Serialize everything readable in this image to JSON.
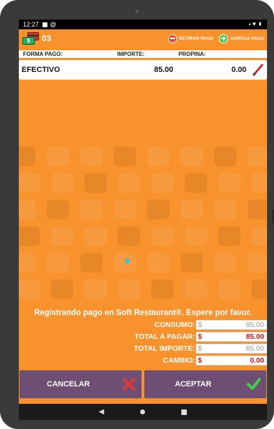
{
  "status": {
    "time": "12:27",
    "icons_right": "⬩▼▮"
  },
  "header": {
    "card_count": "03",
    "bill_symbol": "$",
    "remove_payment": "RETIRAR PAGO",
    "add_payment": "AGREGA PAGO"
  },
  "columns": {
    "method": "FORMA PAGO:",
    "amount": "IMPORTE:",
    "tip": "PROPINA:"
  },
  "payment": {
    "method": "EFECTIVO",
    "amount": "85.00",
    "tip": "0.00"
  },
  "message": "Registrando pago en Soft Restaurant®. Espere por favor.",
  "totals": [
    {
      "label": "CONSUMO:",
      "currency": "$",
      "value": "85.00",
      "style": "gray"
    },
    {
      "label": "TOTAL A PAGAR:",
      "currency": "$",
      "value": "85.00",
      "style": "red"
    },
    {
      "label": "TOTAL IMPORTE:",
      "currency": "$",
      "value": "85.00",
      "style": "gray"
    },
    {
      "label": "CAMBIO:",
      "currency": "$",
      "value": "0.00",
      "style": "red"
    }
  ],
  "buttons": {
    "cancel": "CANCELAR",
    "accept": "ACEPTAR"
  },
  "colors": {
    "background": "#f7922d",
    "button": "#6e4f73",
    "value_red": "#e01010"
  },
  "icons": [
    "camera-icon",
    "card-money-icon",
    "minus-circle-icon",
    "plus-circle-icon",
    "pencil-icon",
    "close-x-icon",
    "checkmark-icon",
    "back-icon",
    "home-icon",
    "recent-apps-icon"
  ]
}
